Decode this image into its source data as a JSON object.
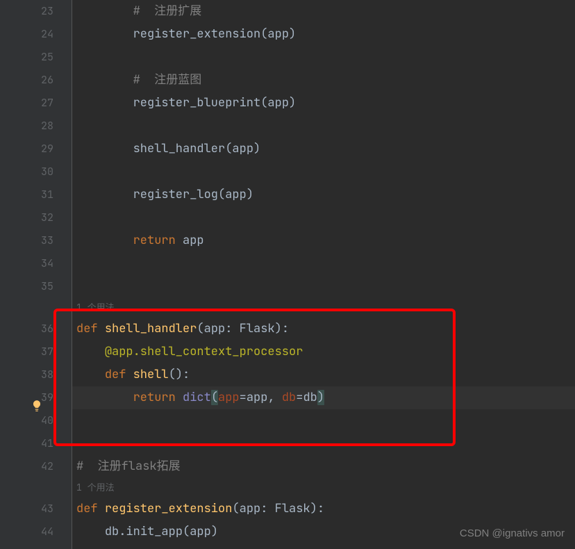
{
  "gutter": {
    "lines": [
      "23",
      "24",
      "25",
      "26",
      "27",
      "28",
      "29",
      "30",
      "31",
      "32",
      "33",
      "34",
      "35",
      "",
      "36",
      "37",
      "38",
      "39",
      "40",
      "41",
      "42",
      "",
      "43",
      "44"
    ]
  },
  "code": {
    "line23": {
      "indent": "        ",
      "comment": "#  注册扩展"
    },
    "line24": {
      "indent": "        ",
      "func": "register_extension",
      "args": "(app)"
    },
    "line25": {
      "indent": ""
    },
    "line26": {
      "indent": "        ",
      "comment": "#  注册蓝图"
    },
    "line27": {
      "indent": "        ",
      "func": "register_blueprint",
      "args": "(app)"
    },
    "line28": {
      "indent": ""
    },
    "line29": {
      "indent": "        ",
      "func": "shell_handler",
      "args": "(app)"
    },
    "line30": {
      "indent": ""
    },
    "line31": {
      "indent": "        ",
      "func": "register_log",
      "args": "(app)"
    },
    "line32": {
      "indent": ""
    },
    "line33": {
      "indent": "        ",
      "kw": "return",
      "val": " app"
    },
    "line34": {
      "indent": ""
    },
    "line35": {
      "indent": ""
    },
    "usage1": {
      "indent": "1 个用法"
    },
    "line36": {
      "indent": "",
      "kw": "def ",
      "name": "shell_handler",
      "sig_open": "(app: ",
      "type": "Flask",
      "sig_close": "):"
    },
    "line37": {
      "indent": "    ",
      "dec": "@app.shell_context_processor"
    },
    "line38": {
      "indent": "    ",
      "kw": "def ",
      "name": "shell",
      "sig": "():"
    },
    "line39": {
      "indent": "        ",
      "kw": "return ",
      "builtin": "dict",
      "open": "(",
      "p1": "app",
      "eq1": "=app, ",
      "p2": "db",
      "eq2": "=db",
      "close": ")"
    },
    "line40": {
      "indent": ""
    },
    "line41": {
      "indent": ""
    },
    "line42": {
      "indent": "",
      "comment": "#  注册flask拓展"
    },
    "usage2": {
      "indent": "1 个用法"
    },
    "line43": {
      "indent": "",
      "kw": "def ",
      "name": "register_extension",
      "sig_open": "(app: ",
      "type": "Flask",
      "sig_close": "):"
    },
    "line44": {
      "indent": "    ",
      "obj": "db.",
      "func": "init_app",
      "args": "(app)"
    }
  },
  "bulb": {
    "name": "lightbulb-icon"
  },
  "watermark": "CSDN @ignativs  amor"
}
